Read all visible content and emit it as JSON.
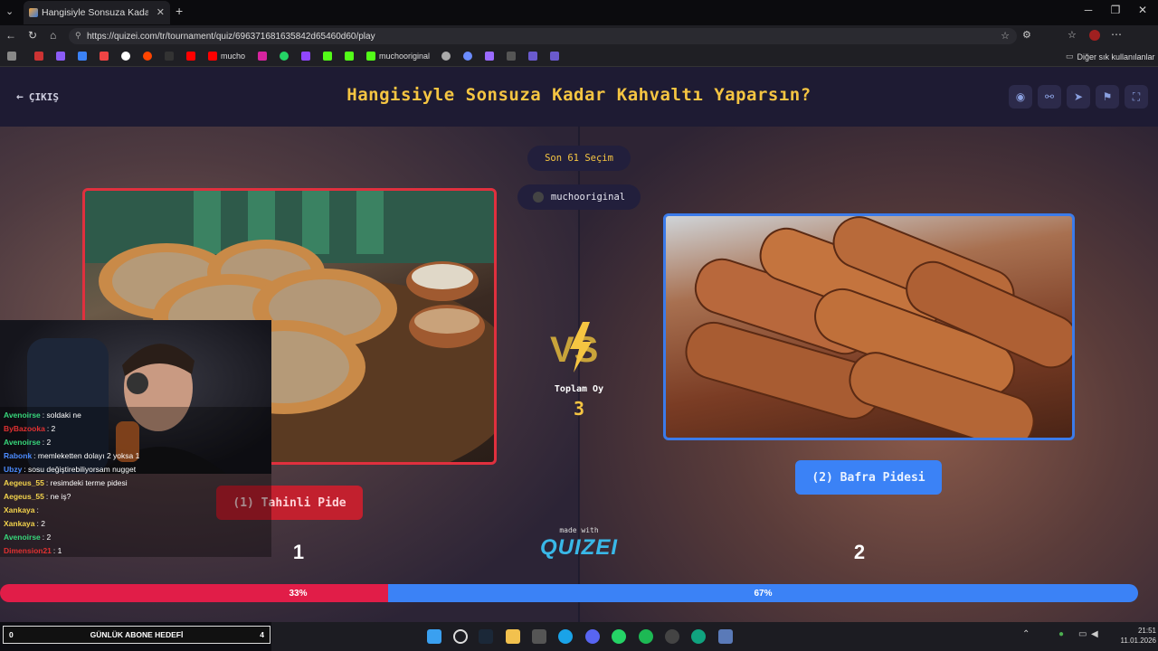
{
  "browser": {
    "tab_title": "Hangisiyle Sonsuza Kadar Kahvaltı",
    "url": "https://quizei.com/tr/tournament/quiz/696371681635842d65460d60/play",
    "bookmarks": [
      "mucho",
      "muchooriginal"
    ],
    "other_bookmarks": "Diğer sık kullanılanlar"
  },
  "header": {
    "exit_label": "ÇIKIŞ",
    "title": "Hangisiyle Sonsuza Kadar Kahvaltı Yaparsın?"
  },
  "quiz": {
    "last_choices": "Son 61 Seçim",
    "creator": "muchooriginal",
    "total_votes_label": "Toplam Oy",
    "total_votes": "3",
    "made_with": "made with",
    "brand": "QUIZEI",
    "option1": {
      "label": "(1) Tahinli Pide",
      "number": "1",
      "percent_label": "33%",
      "percent": 33,
      "color": "#e11d48"
    },
    "option2": {
      "label": "(2) Bafra Pidesi",
      "number": "2",
      "percent_label": "67%",
      "percent": 67,
      "color": "#3b82f6"
    }
  },
  "chat": [
    {
      "user": "Avenoirse",
      "msg": ": soldaki ne",
      "color": "#37d67a"
    },
    {
      "user": "ByBazooka",
      "msg": ": 2",
      "color": "#e03131"
    },
    {
      "user": "Avenoirse",
      "msg": ": 2",
      "color": "#37d67a"
    },
    {
      "user": "Rabonk",
      "msg": ": memleketten dolayı 2 yoksa 1",
      "color": "#4c8cff"
    },
    {
      "user": "Ubzy",
      "msg": ": sosu değiştirebiliyorsam nugget",
      "color": "#4c8cff"
    },
    {
      "user": "Aegeus_55",
      "msg": ": resimdeki terme pidesi",
      "color": "#f2d24c"
    },
    {
      "user": "Aegeus_55",
      "msg": ": ne iş?",
      "color": "#f2d24c"
    },
    {
      "user": "Xankaya",
      "msg": ":",
      "color": "#f2d24c"
    },
    {
      "user": "Xankaya",
      "msg": ": 2",
      "color": "#f2d24c"
    },
    {
      "user": "Avenoirse",
      "msg": ": 2",
      "color": "#37d67a"
    },
    {
      "user": "Dimension21",
      "msg": ": 1",
      "color": "#e03131"
    }
  ],
  "goal": {
    "left": "0",
    "label": "GÜNLÜK ABONE HEDEFİ",
    "right": "4"
  },
  "clock": {
    "time": "21:51",
    "date": "11.01.2026"
  }
}
